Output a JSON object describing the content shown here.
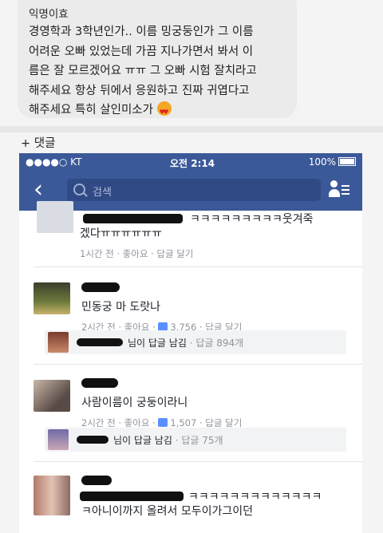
{
  "post": {
    "author": "익명이효",
    "lines": [
      "경영학과 3학년인가.. 이름 밍궁둥인가 그 이름",
      "어려운 오빠 있었는데 가끔 지나가면서 봐서 이",
      "름은 잘 모르겠어요 ㅠㅠ 그 오빠 시험 잘치라고",
      "해주세요 항상 뒤에서 응원하고 진짜 귀엽다고",
      "해주세요 특히 살인미소가"
    ],
    "emoji_icon": "heart-eyes-emoji"
  },
  "comment_label": "+ 댓글",
  "phone": {
    "status": {
      "carrier": "●●●●○ KT",
      "time": "오전 2:14",
      "battery": "100%"
    },
    "nav": {
      "search_placeholder": "검색"
    }
  },
  "comments": [
    {
      "text_visible": "ㅋㅋㅋㅋㅋㅋㅋㅋㅋ웃겨죽",
      "text_line2": "겠다ㅠㅠㅠㅠㅠㅠ",
      "meta": "1시간 전 · 좋아요 · 답글 달기"
    },
    {
      "text": "민동궁 마 도랏나",
      "meta_time": "2시간 전 · 좋아요 ·",
      "likes": "3,756",
      "meta_reply": "· 답글 달기",
      "reply_text": "님이 답글 남김",
      "reply_count": "· 답글 894개"
    },
    {
      "text": "사람이름이 궁둥이라니",
      "meta_time": "2시간 전 · 좋아요 ·",
      "likes": "1,507",
      "meta_reply": "· 답글 달기",
      "reply_text": "님이 답글 남김",
      "reply_count": "· 답글 75개"
    },
    {
      "text_visible": "ㅋㅋㅋㅋㅋㅋㅋㅋㅋㅋㅋㅋㅋ",
      "text_line2": "ㅋ아니이까지 올려서 모두이가그이던"
    }
  ],
  "colors": {
    "facebook_blue": "#3b5998",
    "like_blue": "#5890ff"
  }
}
